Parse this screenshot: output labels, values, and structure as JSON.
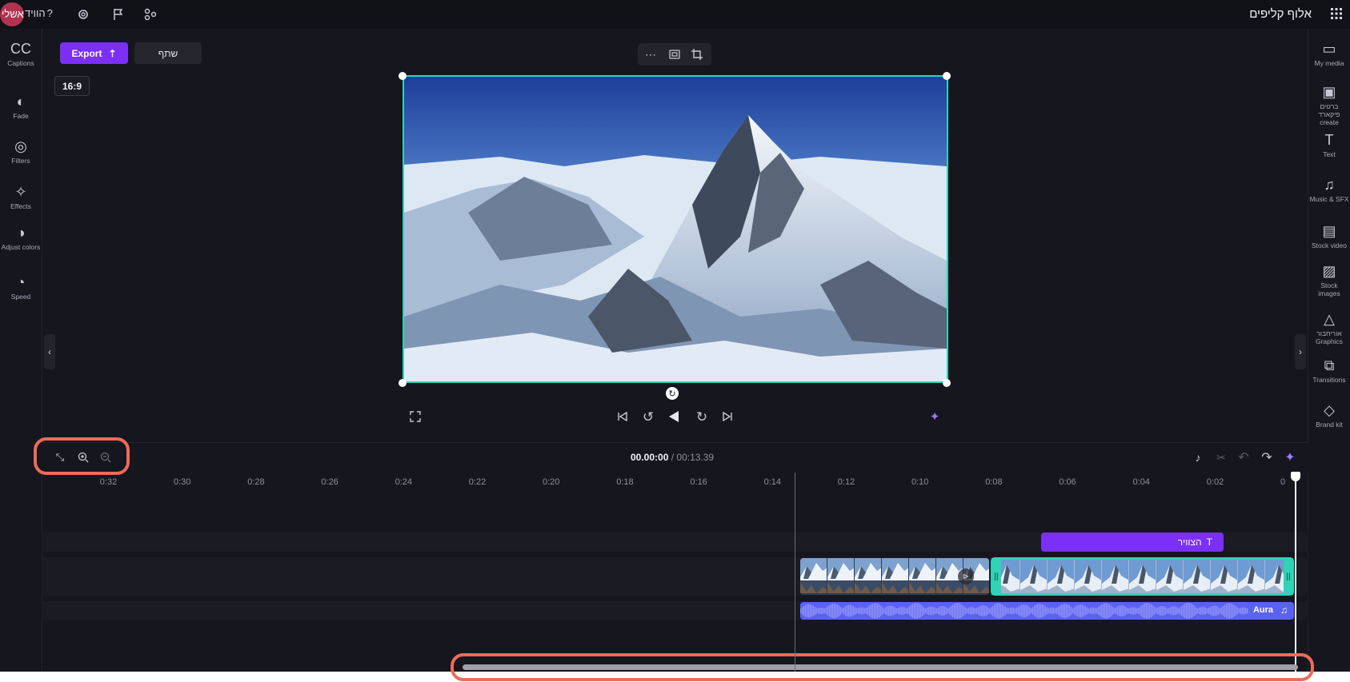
{
  "app": {
    "project_name": "אלוף קליפים",
    "help_label": "הוויד",
    "avatar_initials": "אשלי"
  },
  "topbar": {
    "icons": [
      "apps-grid-icon",
      "settings-icon",
      "flag-icon",
      "share-network-icon"
    ]
  },
  "header": {
    "share_label": "שתף",
    "export_label": "Export",
    "aspect_ratio": "16:9"
  },
  "left_sidebar": {
    "items": [
      {
        "name": "captions",
        "label": "Captions",
        "icon": "CC"
      },
      {
        "name": "fade",
        "label": "Fade",
        "icon": "◐"
      },
      {
        "name": "filters",
        "label": "Filters",
        "icon": "◎"
      },
      {
        "name": "effects",
        "label": "Effects",
        "icon": "✧"
      },
      {
        "name": "adjust-colors",
        "label": "Adjust colors",
        "icon": "◑"
      },
      {
        "name": "speed",
        "label": "Speed",
        "icon": "◔"
      }
    ]
  },
  "right_sidebar": {
    "items": [
      {
        "name": "my-media",
        "label": "My media",
        "icon": "▭"
      },
      {
        "name": "record-create",
        "label": "ברטים פיקארד create",
        "icon": "▣"
      },
      {
        "name": "text",
        "label": "Text",
        "icon": "T"
      },
      {
        "name": "music-sfx",
        "label": "Music & SFX",
        "icon": "♫"
      },
      {
        "name": "stock-video",
        "label": "Stock video",
        "icon": "▤"
      },
      {
        "name": "stock-images",
        "label": "Stock images",
        "icon": "▨"
      },
      {
        "name": "graphics",
        "label": "אוריחבור Graphics",
        "icon": "△"
      },
      {
        "name": "transitions",
        "label": "Transitions",
        "icon": "⧉"
      },
      {
        "name": "brand-kit",
        "label": "Brand kit",
        "icon": "◇"
      }
    ]
  },
  "timeline": {
    "current_time": "00.00:00",
    "total_time": "00:13.39",
    "separator": " / ",
    "ruler_labels": [
      "0",
      "0:02",
      "0:04",
      "0:06",
      "0:08",
      "0:10",
      "0:12",
      "0:14",
      "0:16",
      "0:18",
      "0:20",
      "0:22",
      "0:24",
      "0:26",
      "0:28",
      "0:30",
      "0:32"
    ],
    "text_clip_label": "הצוויר",
    "audio_clip_label": "Aura"
  },
  "colors": {
    "accent": "#7b2ff7",
    "selection": "#2fd3b6",
    "audio": "#5a63f0",
    "highlight": "#ee6b5a",
    "background": "#16161e"
  }
}
